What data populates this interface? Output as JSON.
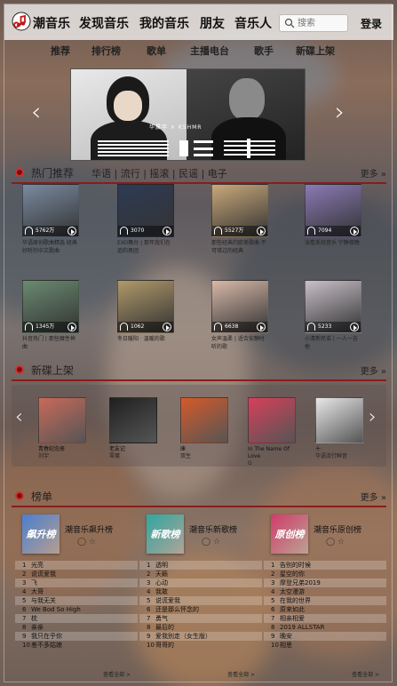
{
  "nav": {
    "brand": "潮音乐",
    "items": [
      "发现音乐",
      "我的音乐",
      "朋友",
      "音乐人"
    ],
    "search_placeholder": "搜索",
    "login": "登录"
  },
  "subnav": [
    "推荐",
    "排行榜",
    "歌单",
    "主播电台",
    "歌手",
    "新碟上架"
  ],
  "banner": {
    "caption": "华晨宇 × KSHMR"
  },
  "hot": {
    "title": "热门推荐",
    "tags": "华语 | 流行 | 摇滚 | 民谣 | 电子",
    "more": "更多",
    "items": [
      {
        "count": "5762万",
        "name": "华语原创歌曲精选 经典好听的中文歌曲",
        "color": "#7a8aa0"
      },
      {
        "count": "3070",
        "name": "EXO舞台 | 那年我们在追的男团",
        "color": "#2e3b55"
      },
      {
        "count": "5527万",
        "name": "那些经典的欧美歌曲 不可错过的经典",
        "color": "#c9a87a"
      },
      {
        "count": "7094",
        "name": "治愈系轻音乐 宁静夜晚",
        "color": "#8a7ab5"
      },
      {
        "count": "1345万",
        "name": "抖音热门 | 那些魔性神曲",
        "color": "#6a8a70"
      },
      {
        "count": "1062",
        "name": "冬日暖阳 · 温暖的歌",
        "color": "#b0996a"
      },
      {
        "count": "6638",
        "name": "女声温柔 | 适合安静时听的歌",
        "color": "#d7b8a8"
      },
      {
        "count": "5233",
        "name": "小清新民谣 | 一人一吉他",
        "color": "#c8c0c8"
      }
    ]
  },
  "new_albums": {
    "title": "新碟上架",
    "more": "更多",
    "items": [
      {
        "name": "青春纪念册",
        "artist": "刘宇",
        "color": "#c86a5a"
      },
      {
        "name": "老友记",
        "artist": "零蛋",
        "color": "#202020"
      },
      {
        "name": "庫",
        "artist": "双生",
        "color": "#d45a2a"
      },
      {
        "name": "In The Name Of Love",
        "artist": "G",
        "color": "#d6405a"
      },
      {
        "name": "十",
        "artist": "华语流行鲜音",
        "color": "#e8e8e8"
      }
    ]
  },
  "charts": {
    "title": "榜单",
    "more": "更多",
    "see_all": "查看全部 >",
    "lists": [
      {
        "badge": "飙升榜",
        "name": "潮音乐飙升榜",
        "color": "#4a7fd0",
        "songs": [
          "光亮",
          "说谎爱我",
          "飞",
          "大哥",
          "与我无关",
          "We Bod So High",
          "枕",
          "亲亲",
          "我只在乎你",
          "差不多姑娘"
        ]
      },
      {
        "badge": "新歌榜",
        "name": "潮音乐新歌榜",
        "color": "#2fa8a0",
        "songs": [
          "透明",
          "天籁",
          "心动",
          "我敢",
          "说谎爱我",
          "还是那么怀念的",
          "勇气",
          "最后的",
          "爱我别走（女生版）",
          "哥哥的"
        ]
      },
      {
        "badge": "原创榜",
        "name": "潮音乐原创榜",
        "color": "#d03c6a",
        "songs": [
          "告别的时候",
          "星空的你",
          "摩登兄弟2019",
          "太空漫游",
          "在我的世界",
          "原来如此",
          "相亲相爱",
          "2019 ALLSTAR",
          "晚安",
          "相思"
        ]
      }
    ]
  }
}
